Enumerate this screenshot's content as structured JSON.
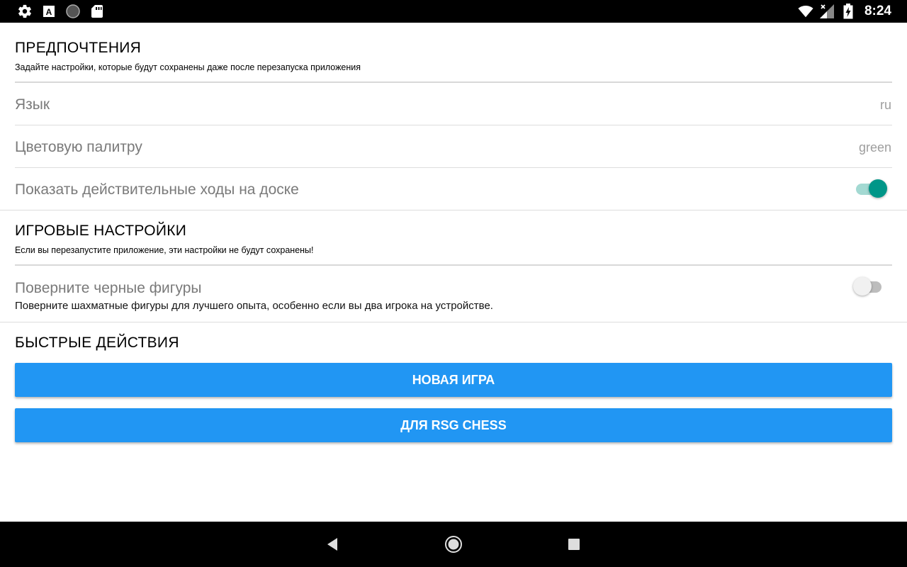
{
  "statusbar": {
    "left_icons": [
      "settings-icon",
      "font-a-icon",
      "circle-icon",
      "sd-card-icon"
    ],
    "right_icons": [
      "wifi-icon",
      "signal-icon",
      "battery-icon"
    ],
    "time": "8:24"
  },
  "preferences": {
    "title": "ПРЕДПОЧТЕНИЯ",
    "subtitle": "Задайте настройки, которые будут сохранены даже после перезапуска приложения",
    "language": {
      "label": "Язык",
      "value": "ru"
    },
    "palette": {
      "label": "Цветовую палитру",
      "value": "green"
    },
    "valid_moves": {
      "label": "Показать действительные ходы на доске",
      "enabled": true
    }
  },
  "game_settings": {
    "title": "ИГРОВЫЕ НАСТРОЙКИ",
    "subtitle": "Если вы перезапустите приложение, эти настройки не будут сохранены!",
    "rotate": {
      "label": "Поверните черные фигуры",
      "summary": "Поверните шахматные фигуры для лучшего опыта, особенно если вы два игрока на устройстве.",
      "enabled": false
    }
  },
  "quick_actions": {
    "title": "БЫСТРЫЕ ДЕЙСТВИЯ",
    "new_game_label": "НОВАЯ ИГРА",
    "about_label": "ДЛЯ RSG CHESS"
  },
  "navbar": {
    "icons": [
      "back-icon",
      "home-icon",
      "recents-icon"
    ]
  },
  "colors": {
    "accent": "#009688",
    "button": "#2196f3",
    "bars": "#000000"
  }
}
